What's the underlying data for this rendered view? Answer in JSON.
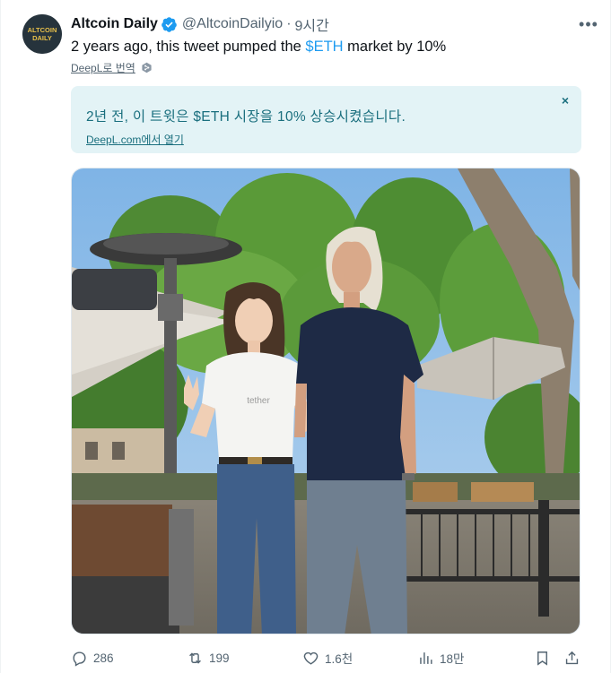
{
  "tweet": {
    "author_name": "Altcoin Daily",
    "handle": "@AltcoinDailyio",
    "separator": "·",
    "time": "9시간",
    "text_before": "2 years ago, this tweet pumped the ",
    "cashtag": "$ETH",
    "text_after": " market by 10%",
    "more_label": "•••",
    "avatar_text_line1": "ALTCOIN",
    "avatar_text_line2": "DAILY"
  },
  "translation": {
    "translate_label": "DeepL로 번역",
    "translated_text": "2년 전, 이 트윗은 $ETH 시장을 10% 상승시켰습니다.",
    "open_link": "DeepL.com에서 열기",
    "close_label": "×"
  },
  "actions": {
    "replies": "286",
    "retweets": "199",
    "likes": "1.6천",
    "views": "18만"
  },
  "colors": {
    "accent": "#1d9bf0",
    "muted": "#536471",
    "translation_bg": "#e3f3f6",
    "translation_text": "#1a6f7e"
  },
  "photo": {
    "shirt_text": "tether"
  }
}
